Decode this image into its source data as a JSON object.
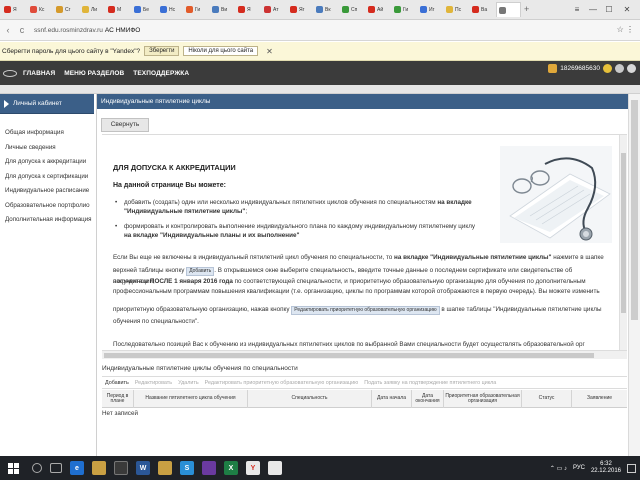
{
  "browser": {
    "tabs": [
      {
        "label": "Я",
        "color": "#d52b1e"
      },
      {
        "label": "Кс",
        "color": "#e04b3a"
      },
      {
        "label": "Сг",
        "color": "#d59a2b"
      },
      {
        "label": "Ли",
        "color": "#e0b53a"
      },
      {
        "label": "М",
        "color": "#d52b1e"
      },
      {
        "label": "Бе",
        "color": "#3a6fd6"
      },
      {
        "label": "Нс",
        "color": "#3a6fd6"
      },
      {
        "label": "Ги",
        "color": "#e25b2a"
      },
      {
        "label": "Ви",
        "color": "#4a7bbd"
      },
      {
        "label": "Я",
        "color": "#d52b1e"
      },
      {
        "label": "Ат",
        "color": "#c33"
      },
      {
        "label": "Яг",
        "color": "#d52b1e"
      },
      {
        "label": "Вк",
        "color": "#4a7bbd"
      },
      {
        "label": "Сп",
        "color": "#3a9a3a"
      },
      {
        "label": "Ай",
        "color": "#d52b1e"
      },
      {
        "label": "Ги",
        "color": "#3a9a3a"
      },
      {
        "label": "Иг",
        "color": "#3a6fd6"
      },
      {
        "label": "Пс",
        "color": "#e0b53a"
      },
      {
        "label": "Ва",
        "color": "#d52b1e"
      },
      {
        "label": "",
        "color": "#777"
      }
    ],
    "tab_add": "+",
    "window_controls": [
      "≡",
      "—",
      "☐",
      "✕"
    ],
    "back": "‹",
    "reload": "c",
    "url_host": "ssnf.edu.rosminzdrav.ru",
    "page_title_in_bar": "АС НМИФО",
    "addr_right": "☆ ⋮"
  },
  "password_bar": {
    "text": "Сберегти пароль для цього сайту в \"Yandex\"?",
    "save": "Зберегти",
    "never": "Ніколи для цього сайта",
    "close": "✕"
  },
  "header": {
    "nav": [
      "ГЛАВНАЯ",
      "МЕНЮ РАЗДЕЛОВ",
      "ТЕХПОДДЕРЖКА"
    ],
    "user_id": "18269685630"
  },
  "sidebar": {
    "title": "Личный кабинет",
    "items": [
      "Общая информация",
      "Личные сведения",
      "Для допуска к аккредитации",
      "Для допуска к сертификации",
      "Индивидуальное расписание",
      "Образовательное портфолио",
      "Дополнительная информация"
    ]
  },
  "main": {
    "panel_title": "Индивидуальные пятилетние циклы",
    "collapse": "Свернуть",
    "heading": "ДЛЯ ДОПУСКА К АККРЕДИТАЦИИ",
    "subheading": "На данной странице Вы можете:",
    "bullet1_a": "добавить (создать) один или несколько индивидуальных пятилетних циклов обучения по специальностям",
    "bullet1_b": "на вкладке \"Индивидуальные пятилетние циклы\"",
    "bullet2_a": "формировать и контролировать выполнение индивидуального плана по каждому индивидуальному пятилетнему циклу",
    "bullet2_b": "на вкладке \"Индивидуальные планы и их выполнение\"",
    "para1_a": "Если Вы еще не включены в индивидуальный пятилетний цикл обучения по специальности, то",
    "para1_b": "на вкладке \"Индивидуальные пятилетние циклы\"",
    "para1_c": "нажмите в шапке",
    "para2_a": "верхней таблицы кнопку",
    "tip_add": "Добавить",
    "para2_b": ". В открывшемся окне выберите специальность, введите точные данные о последнем сертификате или свидетельстве об аккредитации,",
    "para3_a": "полученном",
    "para3_b": "ПОСЛЕ 1 января 2016 года",
    "para3_c": "по соответствующей специальности, и приоритетную образовательную организацию для обучения по дополнительным",
    "para4": "профессиональным программам повышения квалификации (т.е. организацию, циклы по программам которой отображаются в первую очередь). Вы можете изменить",
    "para5_a": "приоритетную образовательную организацию, нажав кнопку",
    "tip_edit": "Редактировать приоритетную образовательную организацию",
    "para5_b": "в шапке таблицы \"Индивидуальные пятилетние циклы",
    "para6": "обучения по специальности\".",
    "para7": "Последовательно позиций Вас к обучению из индивидуальных пятилетних циклов по выбранной Вами специальности будет осуществлять образовательной орг"
  },
  "table": {
    "title": "Индивидуальные пятилетние циклы обучения по специальности",
    "toolbar": [
      {
        "label": "Добавить",
        "enabled": true
      },
      {
        "label": "Редактировать",
        "enabled": false
      },
      {
        "label": "Удалить",
        "enabled": false
      },
      {
        "label": "Редактировать приоритетную образовательную организацию",
        "enabled": false
      },
      {
        "label": "Подать заявку на подтверждение пятилетнего цикла",
        "enabled": false
      }
    ],
    "columns": [
      "Период в плане",
      "Название пятилетнего цикла обучения",
      "Специальность",
      "Дата начала",
      "Дата окончания",
      "Приоритетная образовательная организация",
      "Статус",
      "Заявление"
    ],
    "empty": "Нет записей"
  },
  "taskbar": {
    "lang": "РУС",
    "time": "6:32",
    "date": "22.12.2016"
  }
}
